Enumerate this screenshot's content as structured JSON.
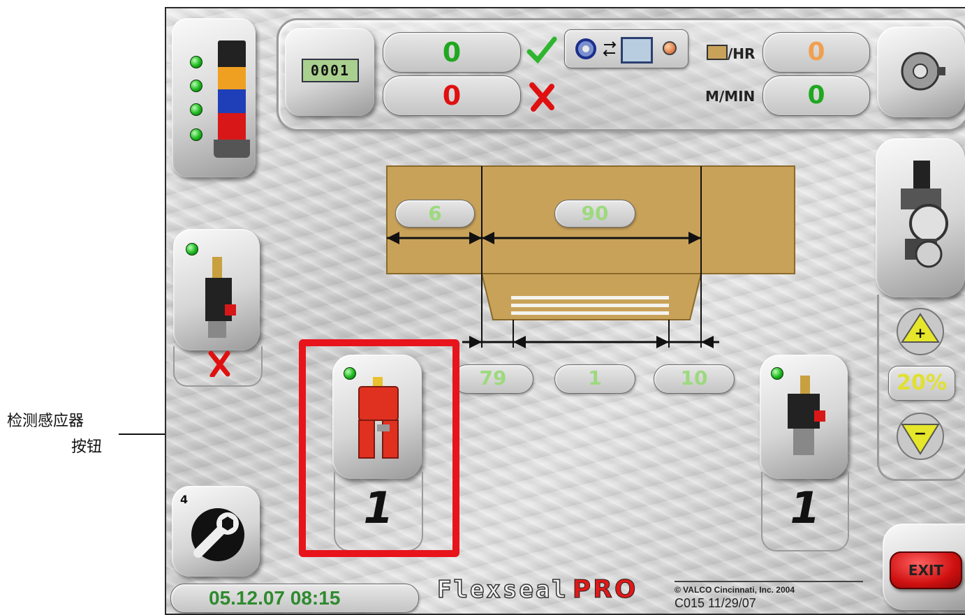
{
  "annotation": {
    "line1": "检测感应器",
    "line2": "按钮"
  },
  "counters": {
    "good": "0",
    "bad": "0",
    "counter_display": "0001",
    "rate_label": "/HR",
    "rate_value": "0",
    "speed_label": "M/MIN",
    "speed_value": "0"
  },
  "dimensions": {
    "top_left": "6",
    "top_right": "90",
    "bottom_left": "79",
    "bottom_mid": "1",
    "bottom_right": "10"
  },
  "sensor": {
    "count": "1"
  },
  "valve_right": {
    "count": "1"
  },
  "pressure": {
    "percent": "20%"
  },
  "tools": {
    "badge": "4"
  },
  "footer": {
    "datetime": "05.12.07 08:15",
    "brand_a": "Flexseal",
    "brand_b": "PRO",
    "copyright": "© VALCO Cincinnati, Inc. 2004",
    "version": "C015 11/29/07"
  },
  "exit": {
    "label": "EXIT"
  },
  "colors": {
    "green_text": "#1fa81f",
    "red_text": "#e01010",
    "orange_text": "#f0a050",
    "highlight": "#e8141b",
    "board": "#c9a25a"
  }
}
